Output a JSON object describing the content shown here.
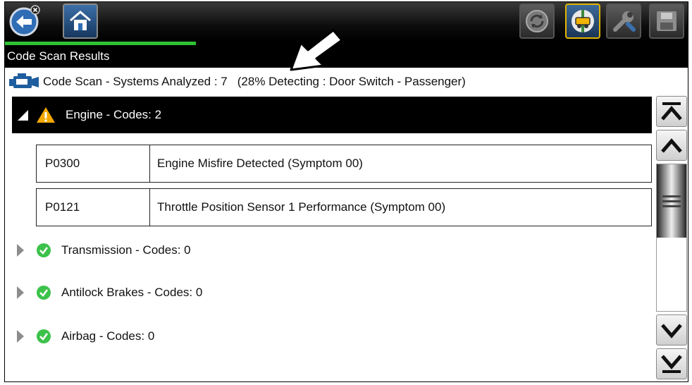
{
  "toolbar": {
    "back_icon": "back-arrow-icon",
    "home_icon": "home-icon",
    "right_icons": [
      "refresh-icon",
      "code-scan-icon",
      "tools-icon",
      "save-icon"
    ],
    "progress_percent": 28,
    "progress_color": "#2fc234"
  },
  "title": "Code Scan Results",
  "status": {
    "label": "Code Scan - Systems Analyzed : 7",
    "detecting": "(28% Detecting : Door Switch - Passenger)"
  },
  "systems": [
    {
      "label": "Engine - Codes: 2",
      "expanded": true,
      "status_icon": "warning-icon",
      "codes": [
        {
          "code": "P0300",
          "description": "Engine Misfire Detected (Symptom 00)"
        },
        {
          "code": "P0121",
          "description": "Throttle Position Sensor 1 Performance (Symptom 00)"
        }
      ]
    },
    {
      "label": "Transmission - Codes: 0",
      "expanded": false,
      "status_icon": "check-icon"
    },
    {
      "label": "Antilock Brakes - Codes: 0",
      "expanded": false,
      "status_icon": "check-icon"
    },
    {
      "label": "Airbag - Codes: 0",
      "expanded": false,
      "status_icon": "check-icon"
    }
  ],
  "scrollbar": {
    "icons": [
      "scroll-top-icon",
      "scroll-up-icon",
      "scroll-down-icon",
      "scroll-bottom-icon"
    ],
    "position_fraction": 0.0
  },
  "colors": {
    "warning": "#f5a800",
    "ok": "#3cc24a",
    "accent_border": "#e2b400"
  }
}
